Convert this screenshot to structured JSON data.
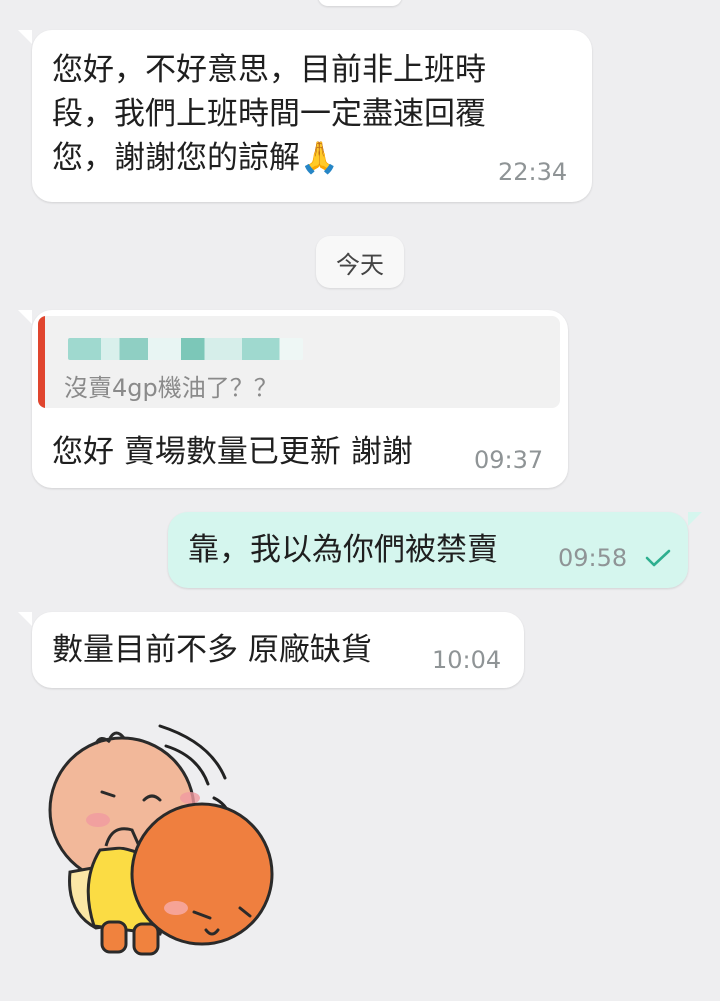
{
  "messages": [
    {
      "lines": [
        "您好，不好意思，目前非上班時",
        "段，我們上班時間一定盡速回覆",
        "您，謝謝您的諒解🙏"
      ],
      "time": "22:34"
    }
  ],
  "date_separator": "今天",
  "reply": {
    "quoted_text": "沒賣4gp機油了？？",
    "text": "您好 賣場數量已更新 謝謝",
    "time": "09:37"
  },
  "outgoing": {
    "text": "靠，我以為你們被禁賣",
    "time": "09:58",
    "status_icon": "check-icon"
  },
  "incoming_2": {
    "text": "數量目前不多 原廠缺貨",
    "time": "10:04"
  },
  "sticker": {
    "icon": "bowing-characters-sticker"
  },
  "colors": {
    "background": "#eeeef0",
    "incoming_bubble": "#ffffff",
    "outgoing_bubble": "#d5f6ee",
    "quote_bar": "#e0452e",
    "check": "#2eaf8f"
  }
}
